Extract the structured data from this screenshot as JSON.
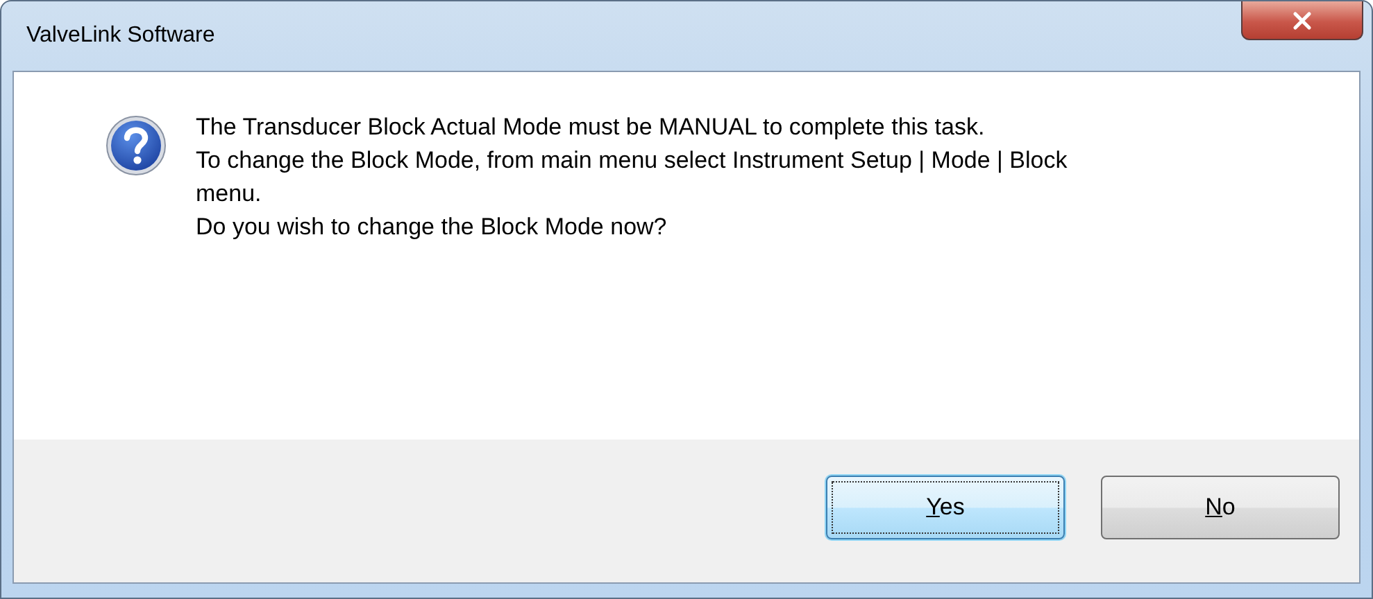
{
  "window": {
    "title": "ValveLink Software"
  },
  "message": {
    "lines": [
      "The Transducer Block Actual Mode must be MANUAL to complete this task.",
      "To change the Block Mode, from main menu select Instrument Setup | Mode | Block menu.",
      "Do you wish to change the Block Mode now?"
    ]
  },
  "buttons": [
    {
      "label": "Yes",
      "default": true
    },
    {
      "label": "No",
      "default": false
    }
  ]
}
